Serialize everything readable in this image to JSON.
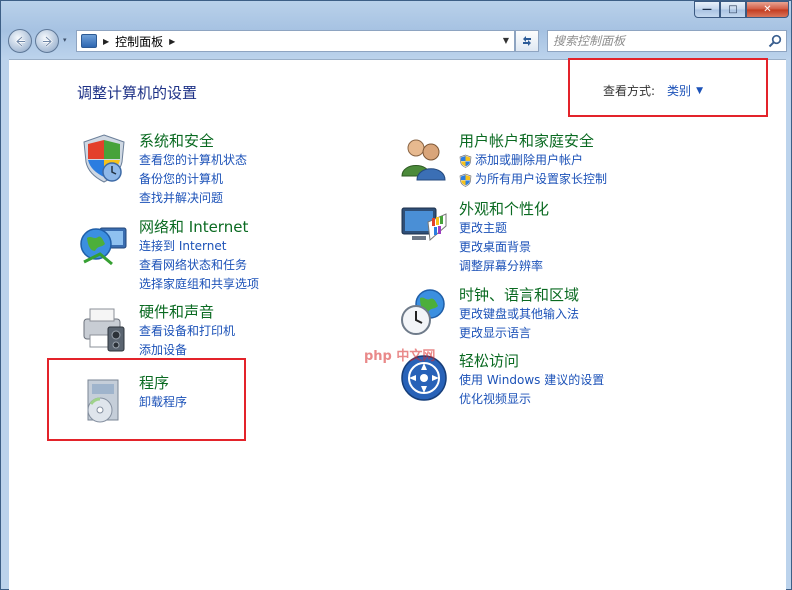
{
  "window": {
    "caption_buttons": {
      "minimize": "—",
      "maximize": "□",
      "close": "✕"
    }
  },
  "nav": {
    "back_icon": "back-arrow-icon",
    "forward_icon": "forward-arrow-icon",
    "history_icon": "▾"
  },
  "address": {
    "arrow": "▶",
    "breadcrumb": "控制面板",
    "dropdown": "▼",
    "refresh_icon": "refresh-icon"
  },
  "search": {
    "placeholder": "搜索控制面板"
  },
  "main": {
    "title": "调整计算机的设置",
    "view_by": {
      "label": "查看方式:",
      "value": "类别",
      "arrow": "▼"
    }
  },
  "left_categories": [
    {
      "title": "系统和安全",
      "icon": "shield-flag-icon",
      "links": [
        "查看您的计算机状态",
        "备份您的计算机",
        "查找并解决问题"
      ]
    },
    {
      "title": "网络和 Internet",
      "icon": "globe-network-icon",
      "links": [
        "连接到 Internet",
        "查看网络状态和任务",
        "选择家庭组和共享选项"
      ]
    },
    {
      "title": "硬件和声音",
      "icon": "printer-speaker-icon",
      "links": [
        "查看设备和打印机",
        "添加设备"
      ]
    },
    {
      "title": "程序",
      "icon": "programs-disc-icon",
      "links": [
        "卸载程序"
      ]
    }
  ],
  "right_categories": [
    {
      "title": "用户帐户和家庭安全",
      "icon": "users-icon",
      "links": [
        "添加或删除用户帐户",
        "为所有用户设置家长控制"
      ],
      "shielded": [
        true,
        true
      ]
    },
    {
      "title": "外观和个性化",
      "icon": "monitor-palette-icon",
      "links": [
        "更改主题",
        "更改桌面背景",
        "调整屏幕分辨率"
      ]
    },
    {
      "title": "时钟、语言和区域",
      "icon": "clock-globe-icon",
      "links": [
        "更改键盘或其他输入法",
        "更改显示语言"
      ]
    },
    {
      "title": "轻松访问",
      "icon": "ease-of-access-icon",
      "links": [
        "使用 Windows 建议的设置",
        "优化视频显示"
      ]
    }
  ],
  "watermark": "php 中文网",
  "colors": {
    "category_title": "#0a6a21",
    "link": "#1c52b8",
    "page_title": "#1e3287",
    "highlight": "#e3232a"
  }
}
